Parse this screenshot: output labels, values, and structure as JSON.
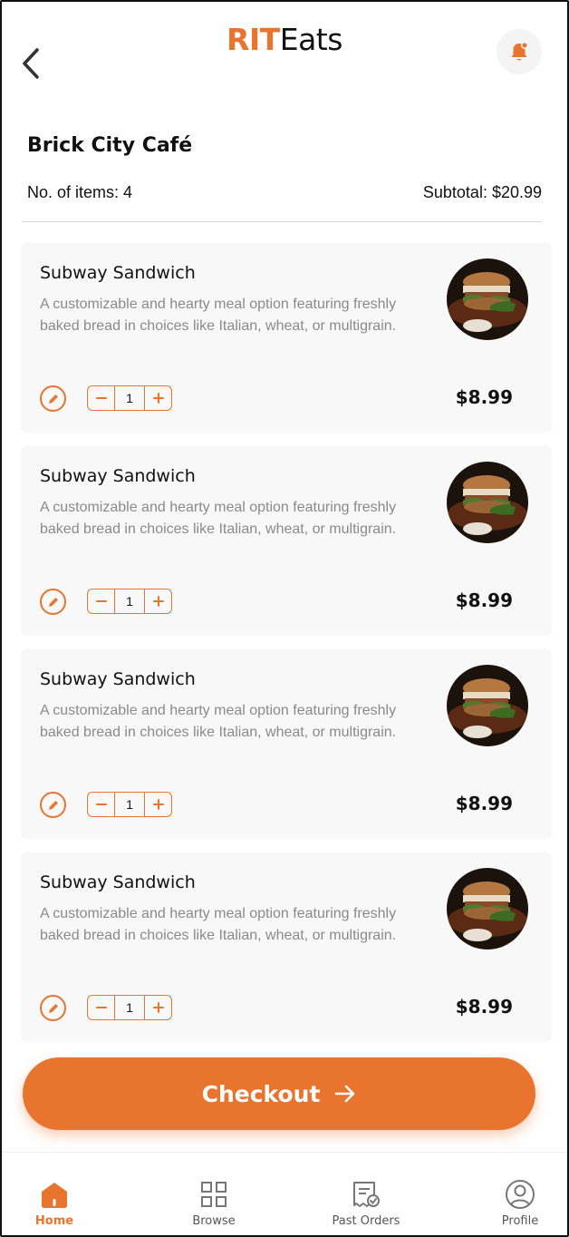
{
  "header": {
    "brand_accent": "RIT",
    "brand_rest": "Eats",
    "back_icon": "chevron-left-icon",
    "notification_icon": "bell-icon"
  },
  "restaurant": {
    "name": "Brick City Café",
    "items_count_label": "No. of items: 4",
    "subtotal_label": "Subtotal: $20.99"
  },
  "cart": {
    "items": [
      {
        "name": "Subway Sandwich",
        "description": "A customizable and hearty meal option featuring freshly baked bread in choices like Italian, wheat, or multigrain.",
        "quantity": "1",
        "price": "$8.99"
      },
      {
        "name": "Subway Sandwich",
        "description": "A customizable and hearty meal option featuring freshly baked bread in choices like Italian, wheat, or multigrain.",
        "quantity": "1",
        "price": "$8.99"
      },
      {
        "name": "Subway Sandwich",
        "description": "A customizable and hearty meal option featuring freshly baked bread in choices like Italian, wheat, or multigrain.",
        "quantity": "1",
        "price": "$8.99"
      },
      {
        "name": "Subway Sandwich",
        "description": "A customizable and hearty meal option featuring freshly baked bread in choices like Italian, wheat, or multigrain.",
        "quantity": "1",
        "price": "$8.99"
      }
    ]
  },
  "checkout": {
    "label": "Checkout",
    "icon": "arrow-right-icon"
  },
  "bottom_nav": {
    "items": [
      {
        "label": "Home",
        "icon": "home-icon",
        "active": true
      },
      {
        "label": "Browse",
        "icon": "grid-icon",
        "active": false
      },
      {
        "label": "Past Orders",
        "icon": "receipt-icon",
        "active": false
      },
      {
        "label": "Profile",
        "icon": "user-icon",
        "active": false
      }
    ]
  },
  "colors": {
    "accent": "#e8742e",
    "card_bg": "#f8f8f8",
    "muted_text": "#8a8a8a"
  }
}
